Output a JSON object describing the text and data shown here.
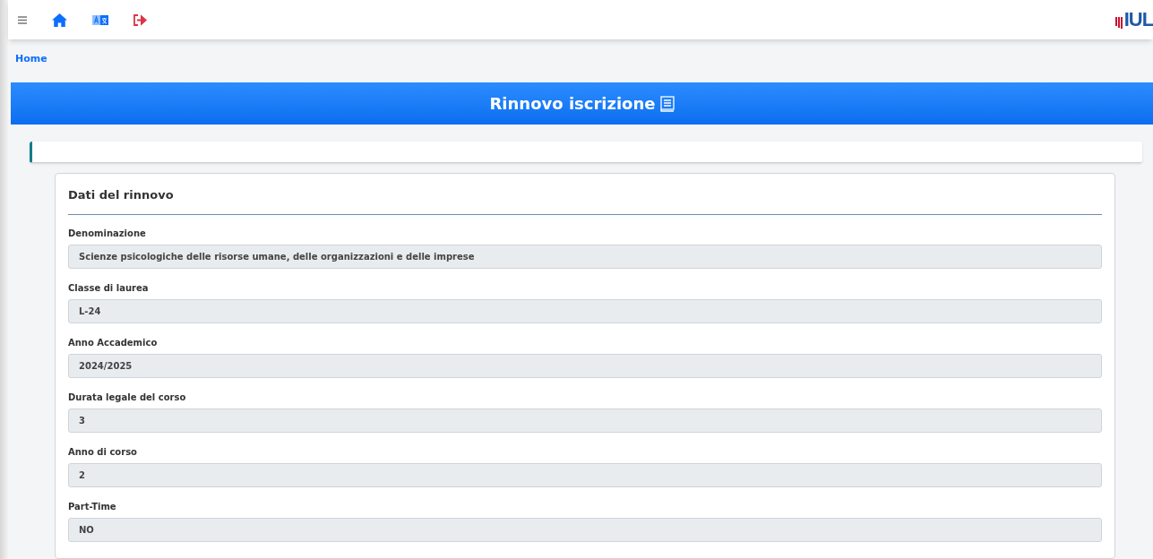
{
  "toolbar": {
    "logo": "IUL"
  },
  "breadcrumb": {
    "label": "Home"
  },
  "banner": {
    "title": "Rinnovo iscrizione"
  },
  "form": {
    "title": "Dati del rinnovo",
    "fields": [
      {
        "label": "Denominazione",
        "value": "Scienze psicologiche delle risorse umane, delle organizzazioni e delle imprese"
      },
      {
        "label": "Classe di laurea",
        "value": "L-24"
      },
      {
        "label": "Anno Accademico",
        "value": "2024/2025"
      },
      {
        "label": "Durata legale del corso",
        "value": "3"
      },
      {
        "label": "Anno di corso",
        "value": "2"
      },
      {
        "label": "Part-Time",
        "value": "NO"
      }
    ]
  }
}
